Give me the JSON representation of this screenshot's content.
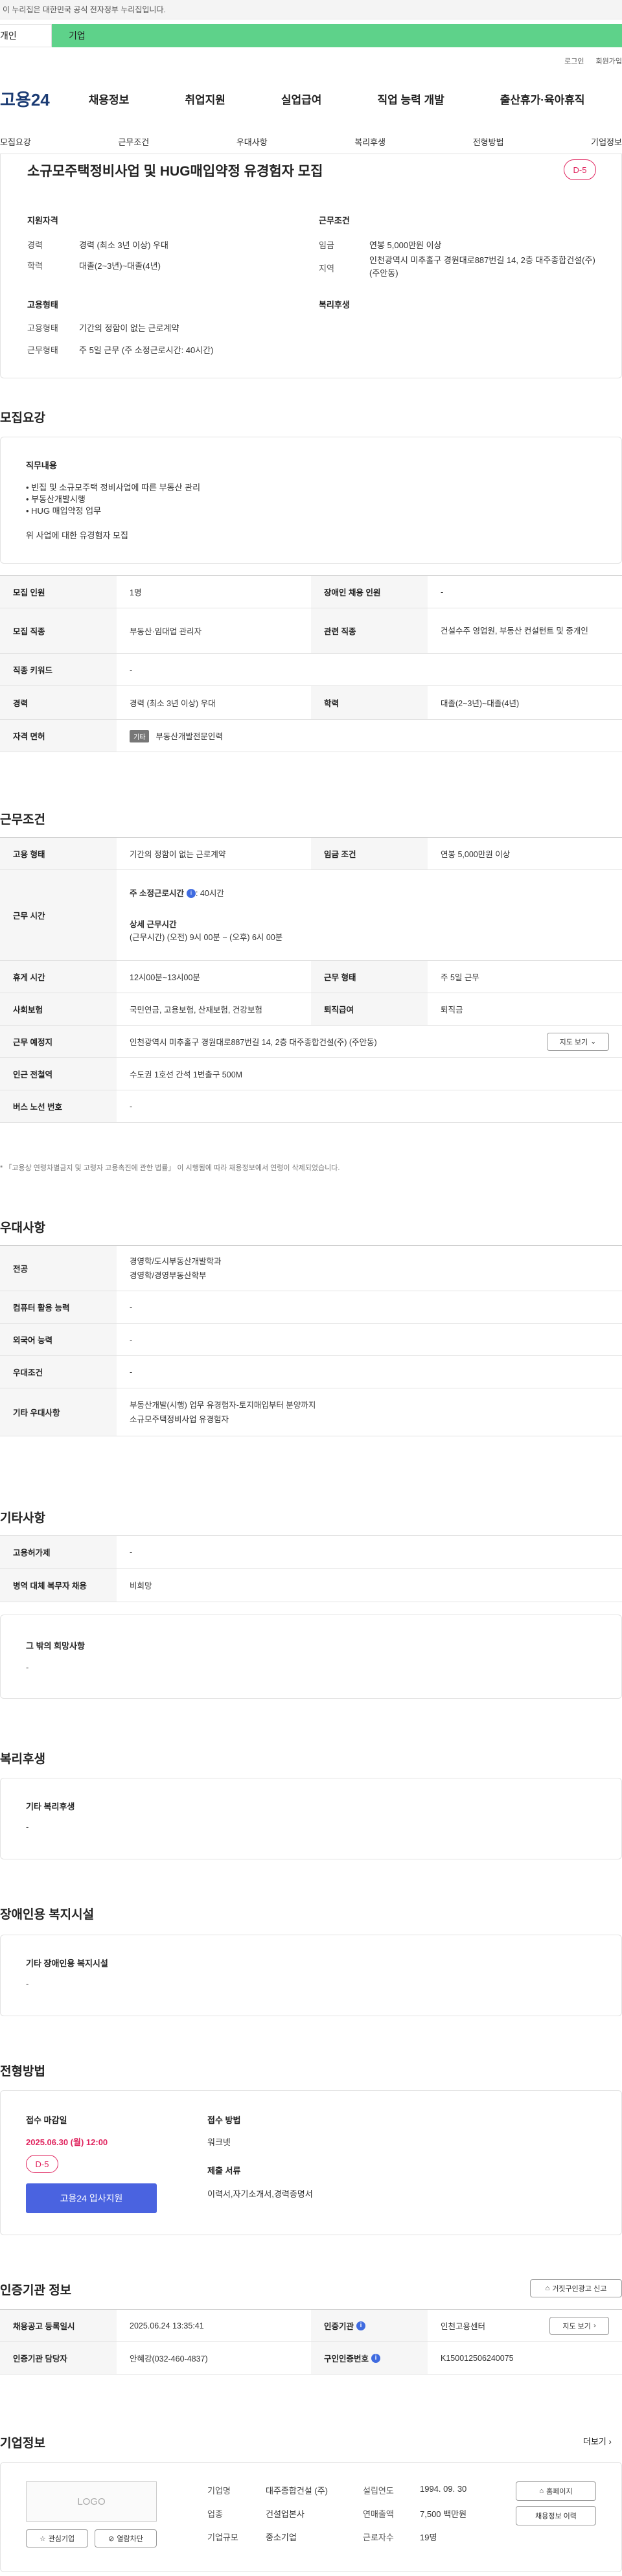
{
  "gov_bar": "이 누리집은 대한민국 공식 전자정부 누리집입니다.",
  "tabs": {
    "person": "개인",
    "company": "기업"
  },
  "top_links": {
    "login": "로그인",
    "signup": "회원가입"
  },
  "logo": "고용24",
  "gnb": [
    "채용정보",
    "취업지원",
    "실업급여",
    "직업 능력 개발",
    "출산휴가·육아휴직"
  ],
  "subnav": [
    "모집요강",
    "근무조건",
    "우대사항",
    "복리후생",
    "전형방법",
    "기업정보"
  ],
  "job": {
    "title": "소규모주택정비사업 및 HUG매입약정 유경험자 모집",
    "dday": "D-5",
    "qual_title": "지원자격",
    "career_label": "경력",
    "career": "경력 (최소 3년 이상) 우대",
    "edu_label": "학력",
    "edu": "대졸(2~3년)~대졸(4년)",
    "cond_title": "근무조건",
    "wage_label": "임금",
    "wage": "연봉 5,000만원 이상",
    "region_label": "지역",
    "region": "인천광역시 미추홀구 경원대로887번길 14, 2층 대주종합건설(주) (주안동)",
    "emp_title": "고용형태",
    "emp_type_label": "고용형태",
    "emp_type": "기간의 정함이 없는 근로계약",
    "work_label": "근무형태",
    "work": "주 5일 근무 (주 소정근로시간: 40시간)",
    "welfare_title": "복리후생"
  },
  "recruit": {
    "section": "모집요강",
    "duty_title": "직무내용",
    "duty_lines": [
      "• 빈집 및 소규모주택 정비사업에 따른 부동산 관리",
      "• 부동산개발시행",
      "• HUG 매입약정 업무",
      "",
      "위 사업에 대한 유경험자 모집"
    ],
    "rows": [
      {
        "h1": "모집 인원",
        "v1": "1명",
        "h2": "장애인 채용 인원",
        "v2": "-"
      },
      {
        "h1": "모집 직종",
        "v1": "부동산·임대업 관리자",
        "h2": "관련 직종",
        "v2": "건설수주 영업원, 부동산 컨설턴트 및 중개인"
      },
      {
        "h1": "직종 키워드",
        "v1": "-"
      },
      {
        "h1": "경력",
        "v1": "경력 (최소 3년 이상) 우대",
        "h2": "학력",
        "v2": "대졸(2~3년)~대졸(4년)"
      },
      {
        "h1": "자격 면허",
        "tag": "기타",
        "v1": "부동산개발전문인력"
      }
    ]
  },
  "conditions": {
    "section": "근무조건",
    "emp_h": "고용 형태",
    "emp_v": "기간의 정함이 없는 근로계약",
    "wage_h": "임금 조건",
    "wage_v": "연봉 5,000만원 이상",
    "hours_h": "근무 시간",
    "hours_line1": "주 소정근로시간",
    "hours_line1b": ": 40시간",
    "hours_detail_title": "상세 근무시간",
    "hours_detail": "(근무시간) (오전) 9시 00분 ~ (오후) 6시 00분",
    "break_h": "휴게 시간",
    "break_v": "12시00분~13시00분",
    "worktype_h": "근무 형태",
    "worktype_v": "주 5일 근무",
    "insurance_h": "사회보험",
    "insurance_v": "국민연금, 고용보험, 산재보험, 건강보험",
    "retire_h": "퇴직급여",
    "retire_v": "퇴직금",
    "place_h": "근무 예정지",
    "place_v": "인천광역시 미추홀구 경원대로887번길 14, 2층 대주종합건설(주) (주안동)",
    "map_btn": "지도 보기",
    "subway_h": "인근 전철역",
    "subway_v": "수도권 1호선 간석 1번출구 500M",
    "bus_h": "버스 노선 번호",
    "bus_v": "-",
    "note": "* 「고용상 연령차별금지 및 고령자 고용촉진에 관한 법률」 이 시행됨에 따라 채용정보에서 연령이 삭제되었습니다."
  },
  "preference": {
    "section": "우대사항",
    "major_h": "전공",
    "major_v1": "경영학/도시부동산개발학과",
    "major_v2": "경영학/경영부동산학부",
    "pc_h": "컴퓨터 활용 능력",
    "pc_v": "-",
    "lang_h": "외국어 능력",
    "lang_v": "-",
    "cond_h": "우대조건",
    "cond_v": "-",
    "etc_h": "기타 우대사항",
    "etc_v1": "부동산개발(시행) 업무 유경험자-토지매입부터 분양까지",
    "etc_v2": "소규모주택정비사업 유경험자"
  },
  "other": {
    "section": "기타사항",
    "support_h": "고용허가제",
    "support_v": "-",
    "military_h": "병역 대체 복무자 채용",
    "military_v": "비희망",
    "hope_title": "그 밖의 희망사항",
    "hope_v": "-"
  },
  "welfare": {
    "section": "복리후생",
    "title": "기타 복리후생",
    "value": "-"
  },
  "disabled": {
    "section": "장애인용 복지시설",
    "title": "기타 장애인용 복지시설",
    "value": "-"
  },
  "selection": {
    "section": "전형방법",
    "deadline_title": "접수 마감일",
    "deadline": "2025.06.30 (월) 12:00",
    "dday": "D-5",
    "apply_btn": "고용24 입사지원",
    "method_title": "접수 방법",
    "method": "워크넷",
    "docs_title": "제출 서류",
    "docs": "이력서,자기소개서,경력증명서"
  },
  "agency": {
    "section": "인증기관 정보",
    "report_btn": "거짓구인광고 신고",
    "reg_h": "채용공고 등록일시",
    "reg_v": "2025.06.24 13:35:41",
    "agency_h": "인증기관",
    "agency_v": "인천고용센터",
    "map_btn": "지도 보기",
    "manager_h": "인증기관 담당자",
    "manager_v": "안혜강(032-460-4837)",
    "num_h": "구인인증번호",
    "num_v": "K150012506240075"
  },
  "company": {
    "section": "기업정보",
    "more": "더보기",
    "logo_placeholder": "LOGO",
    "name_h": "기업명",
    "name_v": "대주종합건설 (주)",
    "founded_h": "설립연도",
    "founded_v": "1994. 09. 30",
    "industry_h": "업종",
    "industry_v": "건설업본사",
    "sales_h": "연매출액",
    "sales_v": "7,500 백만원",
    "size_h": "기업규모",
    "size_v": "중소기업",
    "staff_h": "근로자수",
    "staff_v": "19명",
    "homepage_btn": "홈페이지",
    "history_btn": "채용정보 이력",
    "fav_btn": "관심기업",
    "block_btn": "열람차단"
  }
}
